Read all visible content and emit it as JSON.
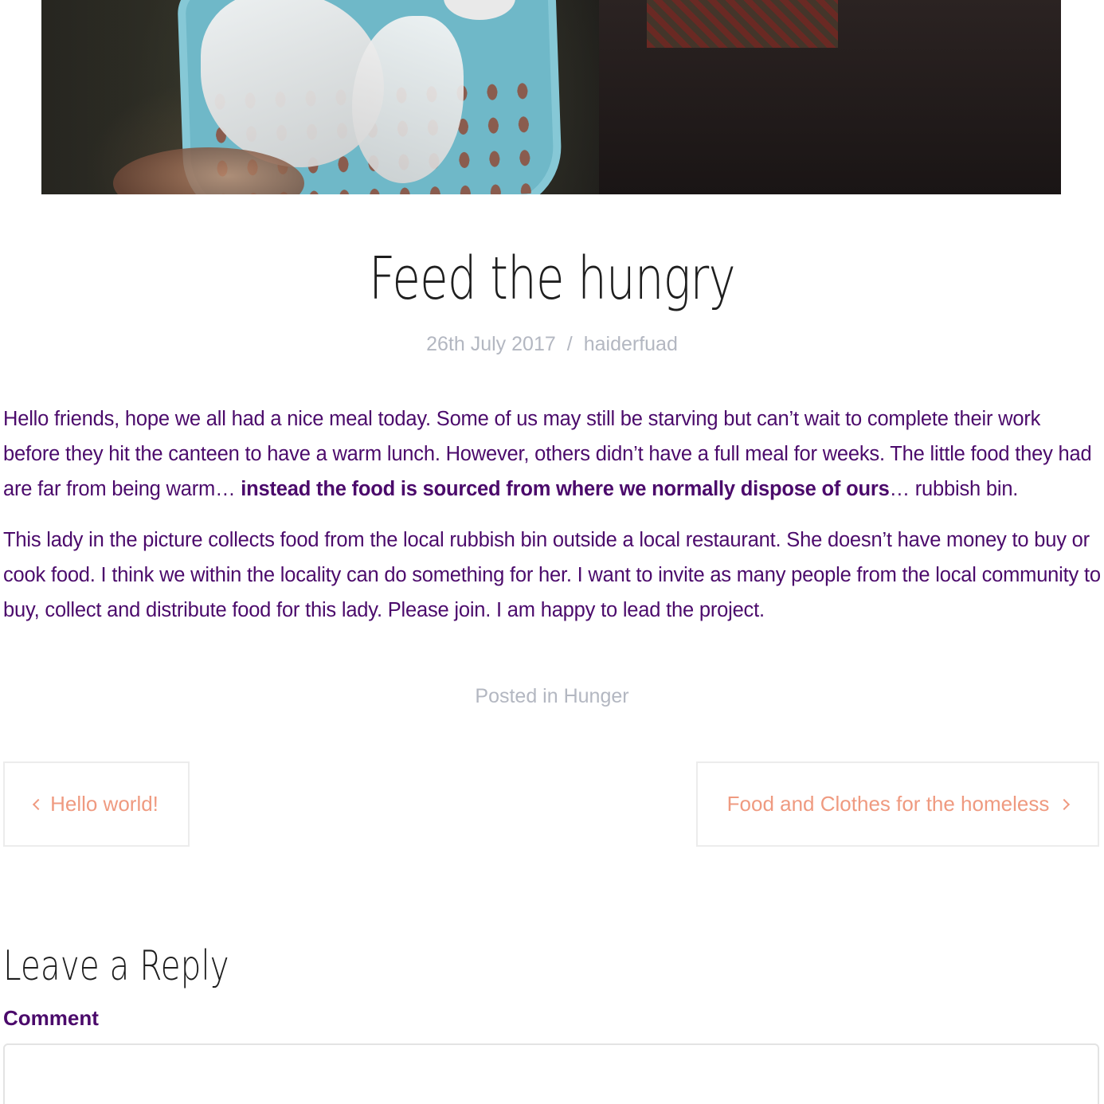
{
  "post": {
    "title": "Feed the hungry",
    "date": "26th July 2017",
    "meta_separator": "/",
    "author": "haiderfuad",
    "paragraph1_part1": "Hello friends, hope we all had a nice meal today. Some of us may still be starving but can’t wait to complete their work before they hit the canteen to have a warm lunch. However, others didn’t have a full meal for weeks. The little food they had are far from being warm… ",
    "paragraph1_bold": "instead the food is sourced from where we normally dispose of ours",
    "paragraph1_part2": "… rubbish bin.",
    "paragraph2": "This lady in the picture collects food from the local rubbish bin outside a local restaurant. She doesn’t have money to buy or cook food. I think we within the locality can do something for her. I want to invite as many people from the local community to buy, collect and distribute food for this lady. Please join. I am happy to lead the project.",
    "posted_in_label": "Posted in",
    "category": "Hunger"
  },
  "navigation": {
    "previous_label": "Hello world!",
    "next_label": "Food and Clothes for the homeless"
  },
  "reply": {
    "title": "Leave a Reply",
    "comment_label": "Comment",
    "comment_value": ""
  },
  "colors": {
    "body_text": "#4b0a6b",
    "meta_text": "#b3b7c1",
    "nav_link": "#ef9a80",
    "heading": "#1e1e1e"
  },
  "icons": {
    "previous": "chevron-left-icon",
    "next": "chevron-right-icon"
  }
}
